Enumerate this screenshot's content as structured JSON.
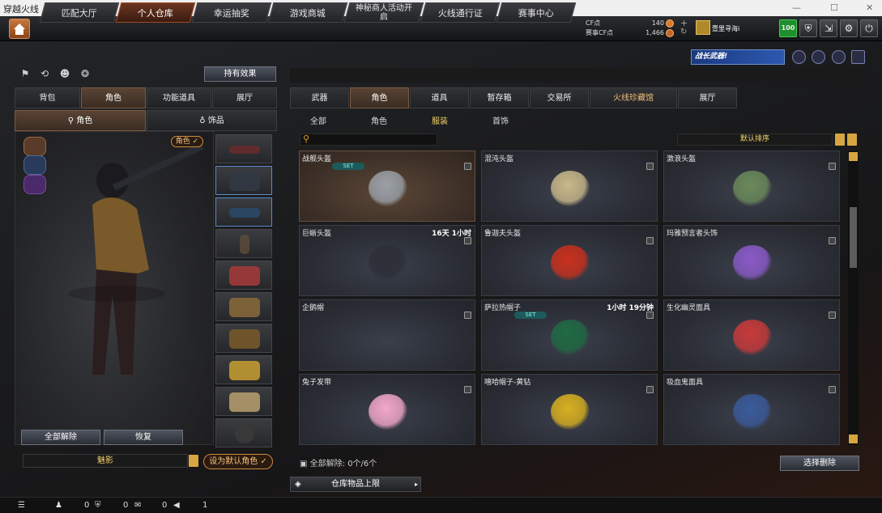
{
  "window": {
    "title": "穿越火线",
    "min": "—",
    "max": "☐",
    "close": "✕"
  },
  "nav": {
    "tabs": [
      "匹配大厅",
      "个人仓库",
      "幸运抽奖",
      "游戏商城",
      "神秘商人活动开启",
      "火线通行证",
      "赛事中心"
    ],
    "active": "个人仓库"
  },
  "currency": {
    "cf_label": "CF点",
    "cf_value": "140",
    "match_label": "赛事CF点",
    "match_value": "1,466"
  },
  "user": {
    "name": "壹里寻海i",
    "level": "100"
  },
  "left": {
    "effect_button": "持有效果",
    "tabs": [
      "背包",
      "角色",
      "功能道具",
      "展厅"
    ],
    "active_tab": "角色",
    "subtabs": [
      "角色",
      "饰品"
    ],
    "char_tag": "角色 ✓",
    "unequip_all": "全部解除",
    "restore": "恢复",
    "char_name": "魅影",
    "set_default": "设为默认角色 ✓"
  },
  "right": {
    "banner": "战长武器!",
    "tabs": [
      "武器",
      "角色",
      "道具",
      "暂存箱",
      "交易所",
      "火线珍藏馆",
      "展厅"
    ],
    "active_tab": "角色",
    "subtabs": [
      "全部",
      "角色",
      "服装",
      "首饰"
    ],
    "active_subtab": "服装",
    "search_placeholder": "",
    "sort": "默认排序",
    "items": [
      {
        "name": "战舰头盔",
        "time": "",
        "set": "SET",
        "color": "#9aa0a8"
      },
      {
        "name": "混沌头盔",
        "time": "",
        "set": "",
        "color": "#c9b88a"
      },
      {
        "name": "激浪头盔",
        "time": "",
        "set": "",
        "color": "#6a8a5a"
      },
      {
        "name": "巨蜥头盔",
        "time": "16天 1小时",
        "set": "",
        "color": "#2c2f38"
      },
      {
        "name": "鲁迦夫头盔",
        "time": "",
        "set": "",
        "color": "#c8301c"
      },
      {
        "name": "玛雅预言者头饰",
        "time": "",
        "set": "",
        "color": "#8a5ac8"
      },
      {
        "name": "企鹅帽",
        "time": "",
        "set": "",
        "color": "#111"
      },
      {
        "name": "萨拉热帽子",
        "time": "1小时 19分钟",
        "set": "SET",
        "color": "#1f6a44"
      },
      {
        "name": "生化幽灵面具",
        "time": "",
        "set": "",
        "color": "#c83a3a"
      },
      {
        "name": "兔子发带",
        "time": "",
        "set": "",
        "color": "#f2a8c8"
      },
      {
        "name": "嘻哈帽子-黄钻",
        "time": "",
        "set": "",
        "color": "#d8b020"
      },
      {
        "name": "吸血鬼面具",
        "time": "",
        "set": "",
        "color": "#3a5a9a"
      }
    ],
    "unequip_info": "全部解除: 0个/6个",
    "delete_selected": "选择删除",
    "capacity": "仓库物品上限"
  },
  "status": {
    "v1": "0",
    "v2": "0",
    "v3": "0",
    "v4": "1"
  }
}
